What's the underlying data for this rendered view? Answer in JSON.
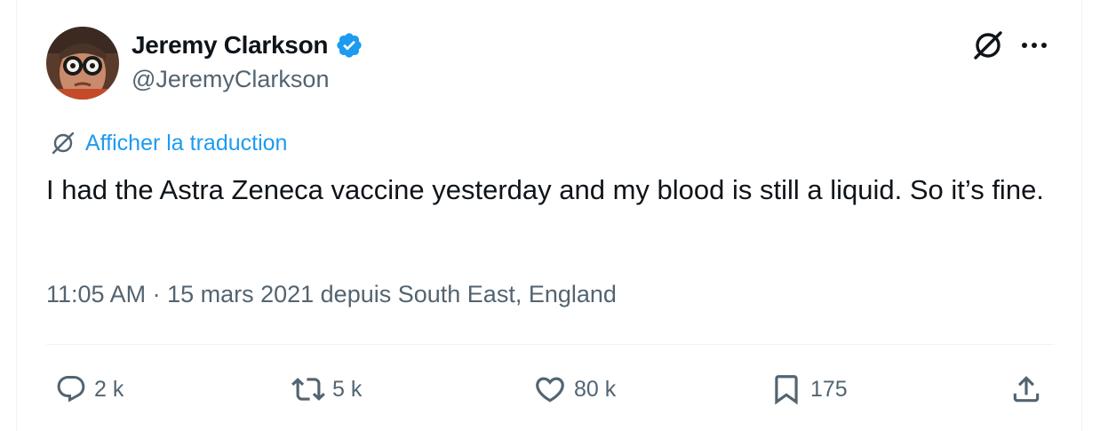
{
  "author": {
    "display_name": "Jeremy Clarkson",
    "handle": "@JeremyClarkson",
    "verified": true,
    "verified_color": "#1d9bf0"
  },
  "translate": {
    "label": "Afficher la traduction",
    "icon": "grok-icon"
  },
  "tweet": {
    "text": "I had the Astra Zeneca vaccine yesterday and my blood is still a liquid. So it’s fine.",
    "meta": "11:05 AM · 15 mars 2021 depuis South East, England"
  },
  "actions": {
    "reply": {
      "icon": "reply-icon",
      "count": "2 k"
    },
    "retweet": {
      "icon": "retweet-icon",
      "count": "5 k"
    },
    "like": {
      "icon": "heart-icon",
      "count": "80 k"
    },
    "bookmark": {
      "icon": "bookmark-icon",
      "count": "175"
    },
    "share": {
      "icon": "share-icon"
    }
  },
  "colors": {
    "text": "#0f1419",
    "secondary": "#536471",
    "accent": "#1d9bf0",
    "divider": "#eff3f4"
  }
}
